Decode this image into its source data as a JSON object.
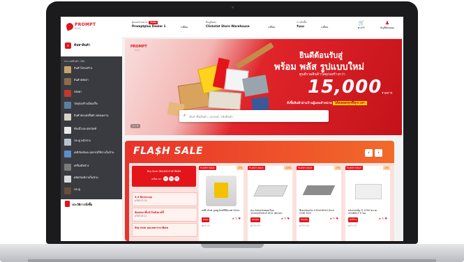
{
  "header": {
    "logo": "PROMPT",
    "logo_sub": "PLUS",
    "dealer_label": "ผู้แทนจำหน่าย",
    "dealer_tag": "ติดต่อ",
    "dealer_name": "Promptplus Dealer 1",
    "change_1": "เปลี่ยน",
    "store_label": "ที่อยู่จัดส่ง",
    "store_name": "Clickstat Store Warehouse",
    "change_2": "เปลี่ยน",
    "shipping_label": "การสั่งซื้อ",
    "shipping_value": "รับเอง",
    "change_3": "เปลี่ยน",
    "cart_label": "ตะกร้า",
    "account_label": "บัญชีของคุณ"
  },
  "sidebar": {
    "search_label": "ค้นหาสินค้า",
    "categories_header": "ประเภทสินค้า (38)",
    "categories": [
      {
        "label": "สินค้าโครงสร้าง"
      },
      {
        "label": "สินค้าหลังคา"
      },
      {
        "label": "หลังคา"
      },
      {
        "label": "วัสดุก่อสร้างเบ็ดเสร็จ"
      },
      {
        "label": "สินค้าตกแต่งพื้นผิว ผนังเพดาน"
      },
      {
        "label": "ห้องน้ำและสุขภัณฑ์"
      },
      {
        "label": "ประตู หน้าต่าง"
      },
      {
        "label": "เคมีภัณฑ์และอุปกรณ์ใช้งานในบ้าน"
      },
      {
        "label": "เครื่องมือช่าง"
      },
      {
        "label": "ผลิตภัณฑ์ภายในบ้าน"
      },
      {
        "label": "ประตู"
      }
    ],
    "service_label": "ประวัติการสั่งซื้อ"
  },
  "banner": {
    "logo": "PROMPT",
    "logo_sub": "PLUS",
    "welcome": "ยินดีต้อนรับสู่",
    "headline": "พร้อม พลัส รูปแบบใหม่",
    "subline": "ศูนย์รวมสินค้าวัสดุก่อสร้างกว่า",
    "number": "15,000",
    "unit": "รายการ",
    "footer": "สั่งซื้อสินค้าผ่านร้านผู้แทนจำหน่าย",
    "footer_highlight": "ได้ตลอดทุกที่ทุกเวลา",
    "pager": "1 / 3",
    "search_placeholder": "ค้นหาชื่อสินค้า, แบรนด์, รหัสสินค้า"
  },
  "flash_sale": {
    "title": "FLA$H SALE",
    "prev": "‹",
    "next": "›",
    "panel_title": "Big Sale ลดแหลกราคาพิเศษ",
    "timer_label": "เหลือเวลา",
    "timer": [
      "12",
      "34",
      "56"
    ],
    "slots": [
      {
        "title": "3.3 ช้อปกระจุย",
        "date": "ครั้งที่ 03.03"
      },
      {
        "title": "ช้อปเหมาสิ้นค้าในสัปดาห์นี้",
        "date": "ครั้งที่ 06.12"
      },
      {
        "title": "Big Sale ลดแหลกราคาพิเศษ",
        "date": ""
      }
    ],
    "products": [
      {
        "badge": "FLASH SALE",
        "discount": "-5%",
        "name": "เทพี เอ็กซ์ ปูนทูเอ็กซ์จีทีเมนต์ 40กก.",
        "unit": "ต่อถุง",
        "price": "฿99.00"
      },
      {
        "badge": "FLASH SALE",
        "discount": "-10%",
        "name": "สมาร์ทบอร์ดซอยเรียบ 120x240x0.8 SCG (8mm)",
        "unit": "ต่อแผ่น",
        "price": "฿299.00"
      },
      {
        "badge": "FLASH SALE",
        "discount": "-7%",
        "name": "ซีเมนต์บอร์ด 120x240x2.0cm (240 SCG",
        "unit": "ต่อแผ่น",
        "price": "฿760.00"
      },
      {
        "badge": "FLASH SALE",
        "discount": "-5%",
        "name": "บล็อกก่ออิฐ Q-CON ขนาด 20x60x7.5 ซม.",
        "unit": "ต่อก้อน",
        "price": "฿35.00"
      }
    ]
  }
}
